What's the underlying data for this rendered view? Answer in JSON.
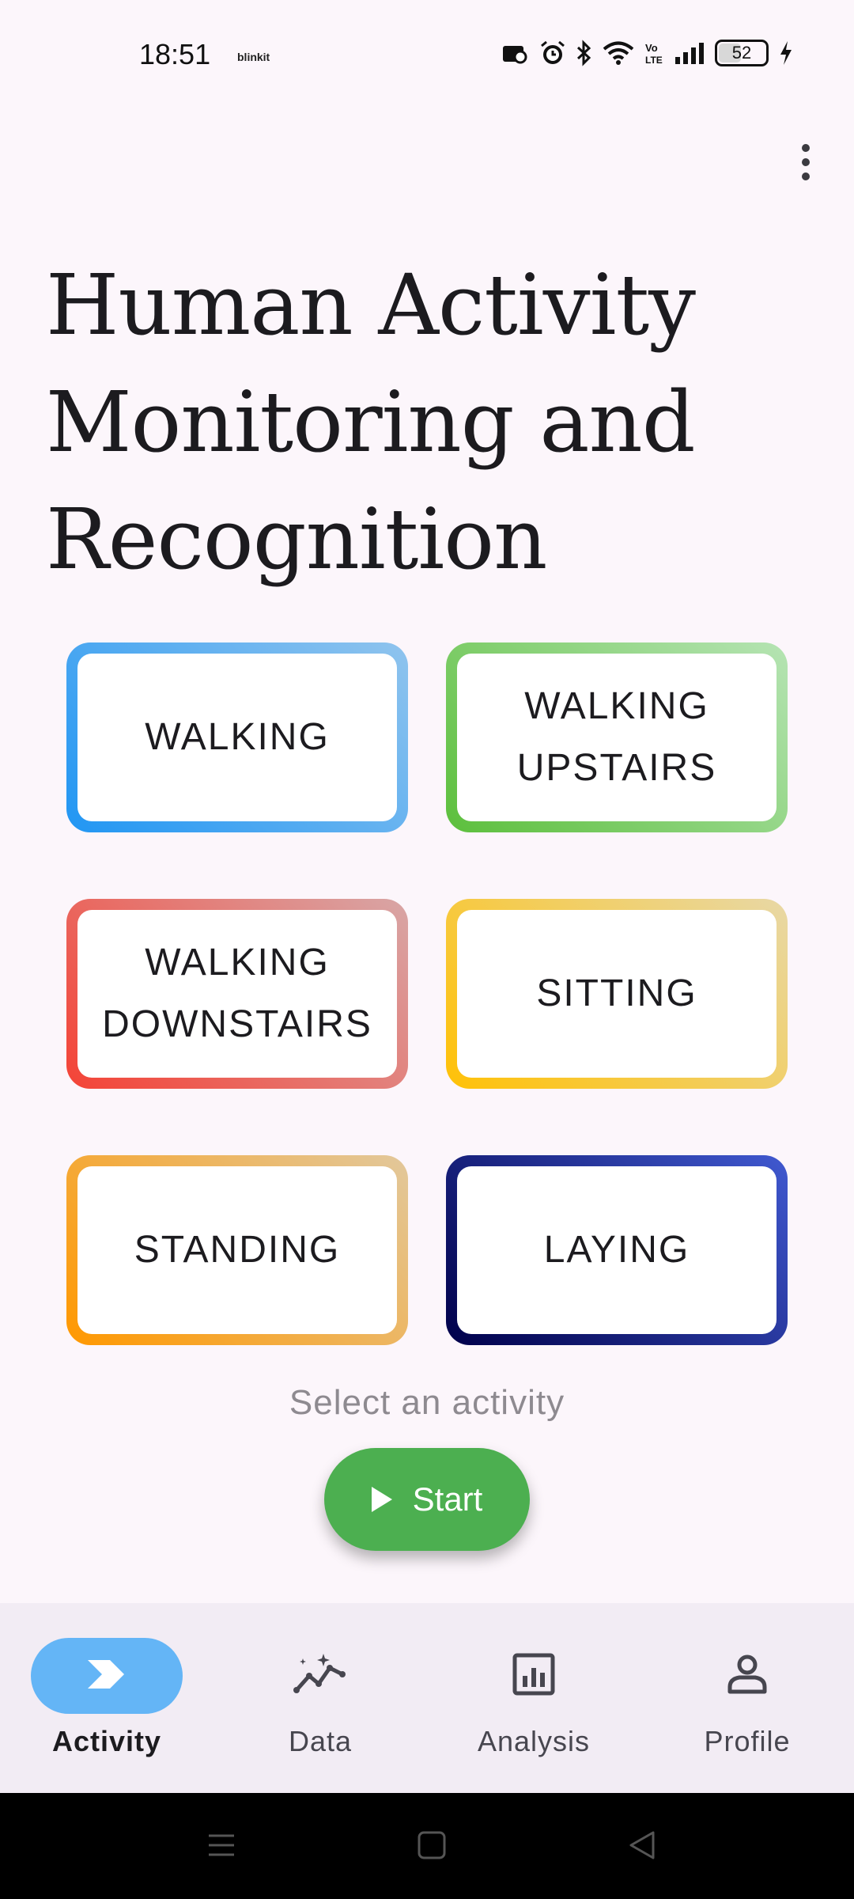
{
  "status_bar": {
    "time": "18:51",
    "app_label": "blinkit",
    "network_label": "Vo LTE",
    "battery_percent": "52",
    "battery_level": 0.52
  },
  "header": {
    "menu_icon": "more-vert-icon"
  },
  "title": "Human Activity Monitoring and Recognition",
  "activities": [
    {
      "label": "WALKING",
      "color_start": "#2196f3",
      "color_end": "#90c4ee"
    },
    {
      "label": "WALKING\nUPSTAIRS",
      "color_start": "#5cbf3c",
      "color_end": "#b6e4b4"
    },
    {
      "label": "WALKING\nDOWNSTAIRS",
      "color_start": "#f44336",
      "color_end": "#d8a6a6"
    },
    {
      "label": "SITTING",
      "color_start": "#ffc107",
      "color_end": "#e8d8a6"
    },
    {
      "label": "STANDING",
      "color_start": "#ff9800",
      "color_end": "#e2c89c"
    },
    {
      "label": "LAYING",
      "color_start": "#00004a",
      "color_end": "#4059d0"
    }
  ],
  "hint": "Select an activity",
  "start_button": {
    "label": "Start",
    "icon": "play-icon",
    "color": "#4caf50"
  },
  "bottom_nav": {
    "active_color": "#64b5f6",
    "items": [
      {
        "label": "Activity",
        "icon": "activity-chevron-icon",
        "active": true
      },
      {
        "label": "Data",
        "icon": "data-chart-icon",
        "active": false
      },
      {
        "label": "Analysis",
        "icon": "analysis-bar-chart-icon",
        "active": false
      },
      {
        "label": "Profile",
        "icon": "person-icon",
        "active": false
      }
    ]
  },
  "system_nav": {
    "icons": [
      "menu-icon",
      "home-icon",
      "back-icon"
    ]
  }
}
